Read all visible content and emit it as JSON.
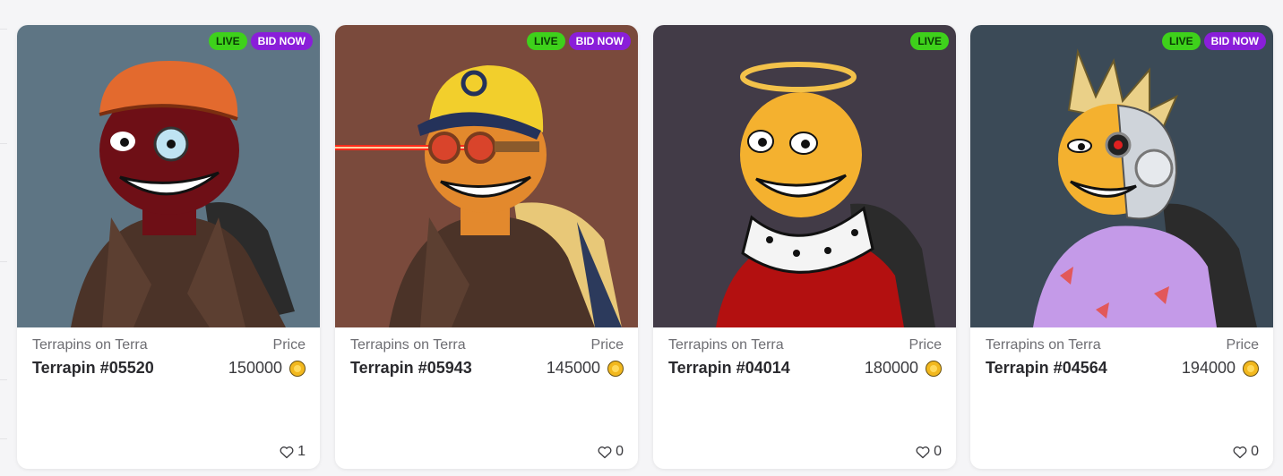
{
  "cards": [
    {
      "collection": "Terrapins on Terra",
      "price_label": "Price",
      "name": "Terrapin #05520",
      "price": "150000",
      "likes": "1",
      "badges": {
        "live": "LIVE",
        "bid": "BID NOW"
      },
      "show_bid": true,
      "background": "#5e7584"
    },
    {
      "collection": "Terrapins on Terra",
      "price_label": "Price",
      "name": "Terrapin #05943",
      "price": "145000",
      "likes": "0",
      "badges": {
        "live": "LIVE",
        "bid": "BID NOW"
      },
      "show_bid": true,
      "background": "#7a4a3c"
    },
    {
      "collection": "Terrapins on Terra",
      "price_label": "Price",
      "name": "Terrapin #04014",
      "price": "180000",
      "likes": "0",
      "badges": {
        "live": "LIVE"
      },
      "show_bid": false,
      "background": "#423b47"
    },
    {
      "collection": "Terrapins on Terra",
      "price_label": "Price",
      "name": "Terrapin #04564",
      "price": "194000",
      "likes": "0",
      "badges": {
        "live": "LIVE",
        "bid": "BID NOW"
      },
      "show_bid": true,
      "background": "#3b4a57"
    }
  ],
  "colors": {
    "live_badge": "#3ed11b",
    "bid_badge": "#8a1ed9",
    "coin": "#f2b81e"
  },
  "icons": {
    "likes": "heart-icon",
    "currency": "luna-coin-icon"
  }
}
